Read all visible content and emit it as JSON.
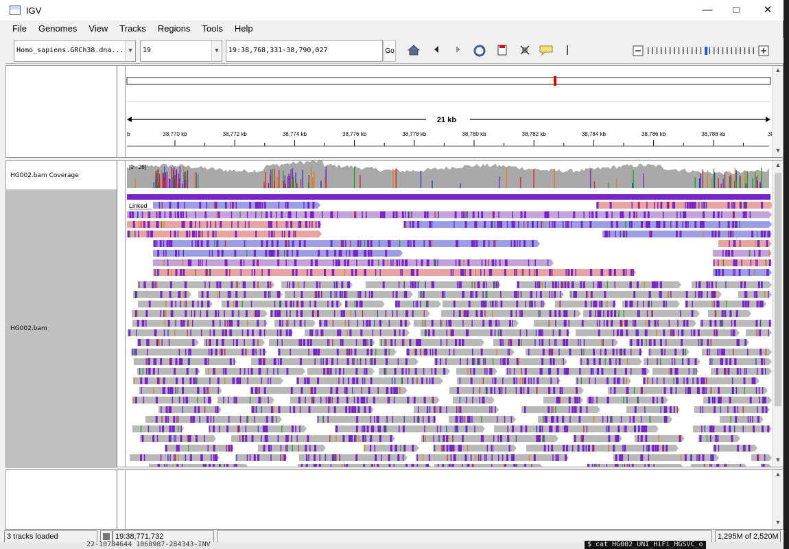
{
  "window": {
    "title": "IGV"
  },
  "menu": [
    "File",
    "Genomes",
    "View",
    "Tracks",
    "Regions",
    "Tools",
    "Help"
  ],
  "toolbar": {
    "genome": "Homo_sapiens.GRCh38.dna...",
    "chromosome": "19",
    "locus": "19:38,768,331-38,790,027",
    "go_label": "Go"
  },
  "ruler": {
    "span_label": "21 kb",
    "left_edge_label": "b",
    "ticks": [
      "38,770 kb",
      "38,772 kb",
      "38,774 kb",
      "38,776 kb",
      "38,778 kb",
      "38,780 kb",
      "38,782 kb",
      "38,784 kb",
      "38,786 kb",
      "38,788 kb",
      "38,7"
    ]
  },
  "tracks": {
    "coverage_name": "HG002.bam Coverage",
    "coverage_range": "[0 - 26]",
    "alignment_name": "HG002.bam",
    "linked_label": "Linked"
  },
  "status": {
    "tracks_loaded": "3 tracks loaded",
    "position": "19:38,771,732",
    "message": "",
    "memory": "1,295M of 2,520M"
  },
  "background_text": {
    "terminal_line": "22-10784644 1068987-284343-INV",
    "terminal_cmd": "$ cat  HG002_UNI_HiFi_HGSVC_o"
  },
  "colors": {
    "coverage_gray": "#a9a9a9",
    "read_gray": "#b9b9b9",
    "insertion_purple": "#7a24c8",
    "linked_blue": "#9d9de6",
    "linked_pink": "#e8a3a3",
    "red_marker": "#e00000"
  },
  "icons": [
    "home-icon",
    "back-icon",
    "forward-icon",
    "refresh-icon",
    "roi-icon",
    "fit-window-icon",
    "popup-info-icon",
    "zoom-out-icon",
    "zoom-in-icon"
  ]
}
